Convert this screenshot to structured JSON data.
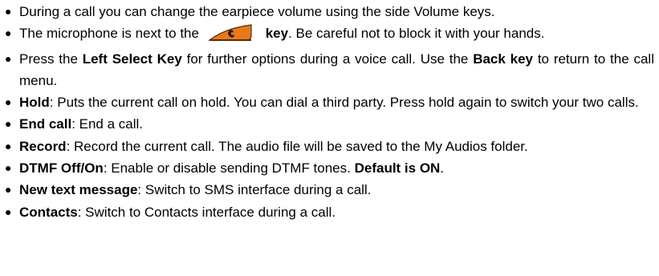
{
  "bullets": [
    {
      "text": "During a call you can change the earpiece volume using the side Volume keys."
    },
    {
      "before": "The microphone is next to the ",
      "icon": "call-key-icon",
      "bold": "key",
      "after": ". Be careful not to block it with your hands."
    },
    {
      "p1": "Press the ",
      "b1": "Left Select Key",
      "p2": " for further options during a voice call. Use the ",
      "b2": "Back key",
      "p3": " to return to the call menu."
    },
    {
      "term": "Hold",
      "desc": ": Puts the current call on hold. You can dial a third party. Press hold again to switch your two calls."
    },
    {
      "term": "End call",
      "desc": ": End a call."
    },
    {
      "term": "Record",
      "desc": ": Record the current call. The audio file will be saved to the My Audios folder."
    },
    {
      "term": "DTMF Off/On",
      "desc": ": Enable or disable sending DTMF tones. ",
      "bold_tail": "Default is ON",
      "end": "."
    },
    {
      "term": "New text message",
      "desc": ": Switch to SMS interface during a call."
    },
    {
      "term": "Contacts",
      "desc": ": Switch to Contacts interface during a call."
    }
  ],
  "colors": {
    "key_fill": "#e87a1e",
    "key_dark": "#5a2a08",
    "handset": "#2a1a10"
  }
}
